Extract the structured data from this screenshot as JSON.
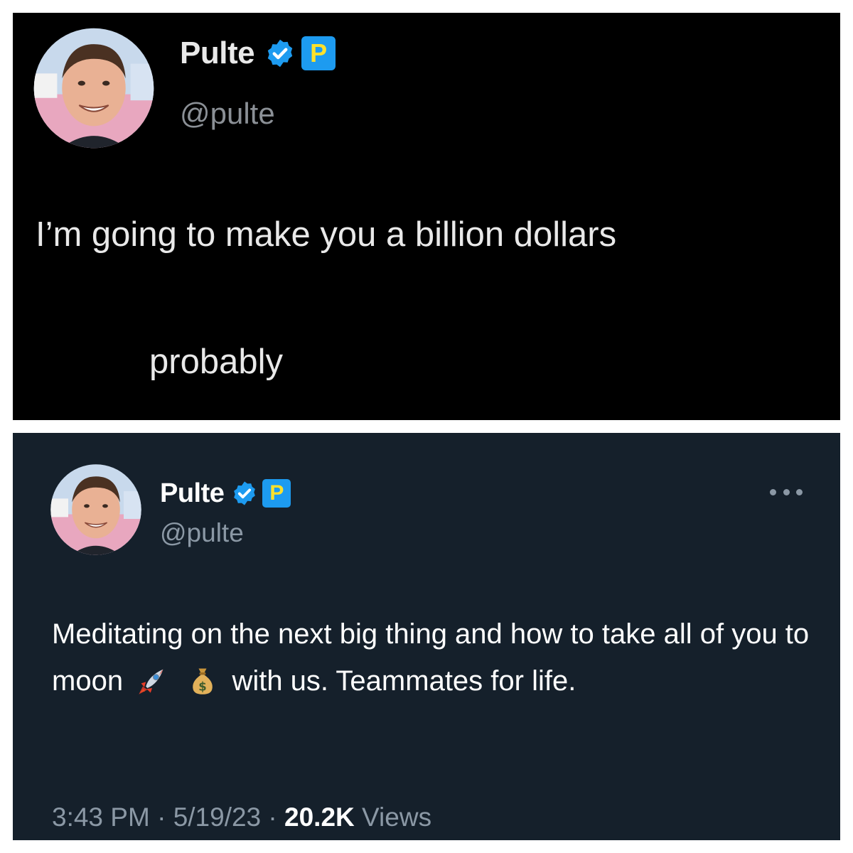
{
  "top_tweet": {
    "display_name": "Pulte",
    "handle": "@pulte",
    "badge_letter": "P",
    "text_line_1": "I’m going to make you a billion dollars",
    "text_line_2": "probably"
  },
  "bottom_tweet": {
    "display_name": "Pulte",
    "handle": "@pulte",
    "badge_letter": "P",
    "text_before_emoji": "Meditating on the next big thing and how to take all of you to moon",
    "emoji_1": "rocket-icon",
    "emoji_2": "money-bag-icon",
    "text_after_emoji": "with us. Teammates for life.",
    "meta": {
      "time": "3:43 PM",
      "separator": " · ",
      "date": "5/19/23",
      "views_count": "20.2K",
      "views_label": "Views"
    }
  },
  "colors": {
    "panel_1_bg": "#000000",
    "panel_2_bg": "#15202b",
    "verified_blue": "#1d9bf0",
    "badge_letter_color": "#ffe12b",
    "secondary_text": "#8b98a5"
  }
}
